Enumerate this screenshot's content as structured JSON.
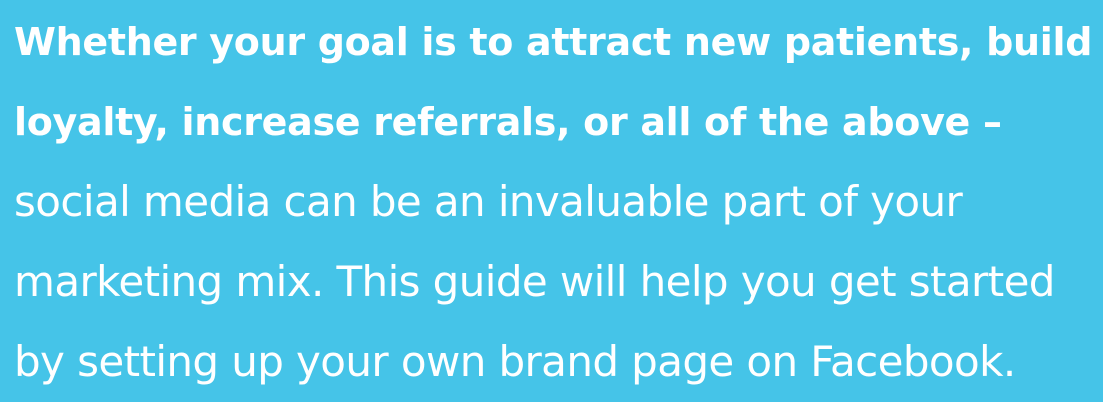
{
  "colors": {
    "background": "#45c4e8",
    "text": "#ffffff"
  },
  "intro": {
    "lines": [
      "Whether your goal is to attract new patients, build",
      "loyalty, increase referrals, or all of the above –",
      "social media can be an invaluable part of your",
      "marketing mix. This guide will help you get started",
      "by setting up your own brand page on Facebook."
    ]
  }
}
